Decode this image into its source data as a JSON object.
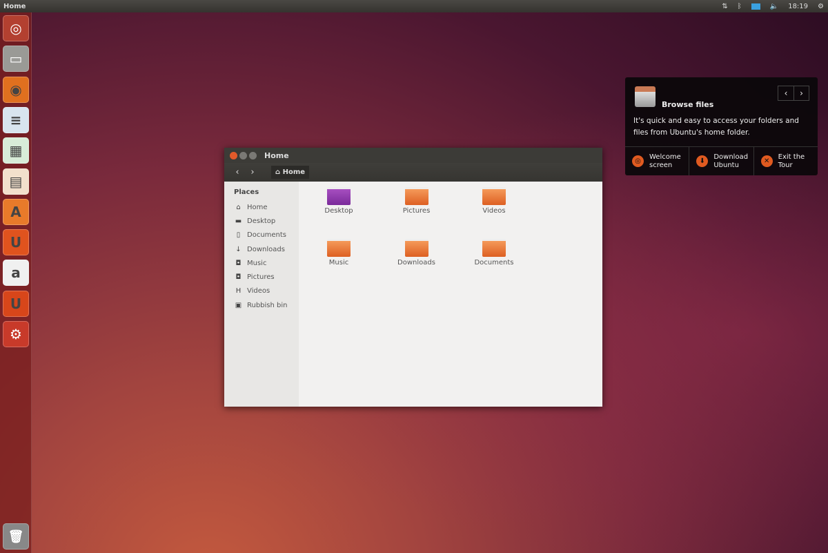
{
  "topbar": {
    "title": "Home",
    "clock": "18:19"
  },
  "launcher": [
    {
      "name": "dash",
      "glyph": "◎",
      "color": "#b34030"
    },
    {
      "name": "files",
      "glyph": "▭",
      "color": "#9a9a96"
    },
    {
      "name": "firefox",
      "glyph": "◉",
      "color": "#e0701f"
    },
    {
      "name": "writer",
      "glyph": "≡",
      "color": "#d8e4ee"
    },
    {
      "name": "calc",
      "glyph": "▦",
      "color": "#d8ecd8"
    },
    {
      "name": "impress",
      "glyph": "▤",
      "color": "#f2e0cc"
    },
    {
      "name": "software-center",
      "glyph": "A",
      "color": "#e87a2a"
    },
    {
      "name": "ubuntu-one",
      "glyph": "U",
      "color": "#e0531e"
    },
    {
      "name": "amazon",
      "glyph": "a",
      "color": "#f0f0f0"
    },
    {
      "name": "ubuntu-one-music",
      "glyph": "U",
      "color": "#d8461a"
    },
    {
      "name": "system-settings",
      "glyph": "⚙",
      "color": "#c83a2a"
    }
  ],
  "trash": {
    "glyph": "🗑"
  },
  "window": {
    "title": "Home",
    "breadcrumb": "Home",
    "places_label": "Places",
    "places": [
      {
        "icon": "home",
        "glyph": "⌂",
        "label": "Home"
      },
      {
        "icon": "desktop",
        "glyph": "▬",
        "label": "Desktop"
      },
      {
        "icon": "document",
        "glyph": "▯",
        "label": "Documents"
      },
      {
        "icon": "download",
        "glyph": "↓",
        "label": "Downloads"
      },
      {
        "icon": "music",
        "glyph": "◘",
        "label": "Music"
      },
      {
        "icon": "camera",
        "glyph": "◘",
        "label": "Pictures"
      },
      {
        "icon": "video",
        "glyph": "H",
        "label": "Videos"
      },
      {
        "icon": "trash",
        "glyph": "▣",
        "label": "Rubbish bin"
      }
    ],
    "files": [
      "Desktop",
      "Pictures",
      "Videos",
      "Music",
      "Downloads",
      "Documents"
    ]
  },
  "tour": {
    "title": "Browse files",
    "text": "It's quick and easy to access your folders and files from Ubuntu's home folder.",
    "buttons": [
      {
        "icon": "ubuntu",
        "glyph": "◎",
        "l1": "Welcome",
        "l2": "screen"
      },
      {
        "icon": "download",
        "glyph": "⬇",
        "l1": "Download",
        "l2": "Ubuntu"
      },
      {
        "icon": "close",
        "glyph": "✕",
        "l1": "Exit the",
        "l2": "Tour"
      }
    ]
  }
}
